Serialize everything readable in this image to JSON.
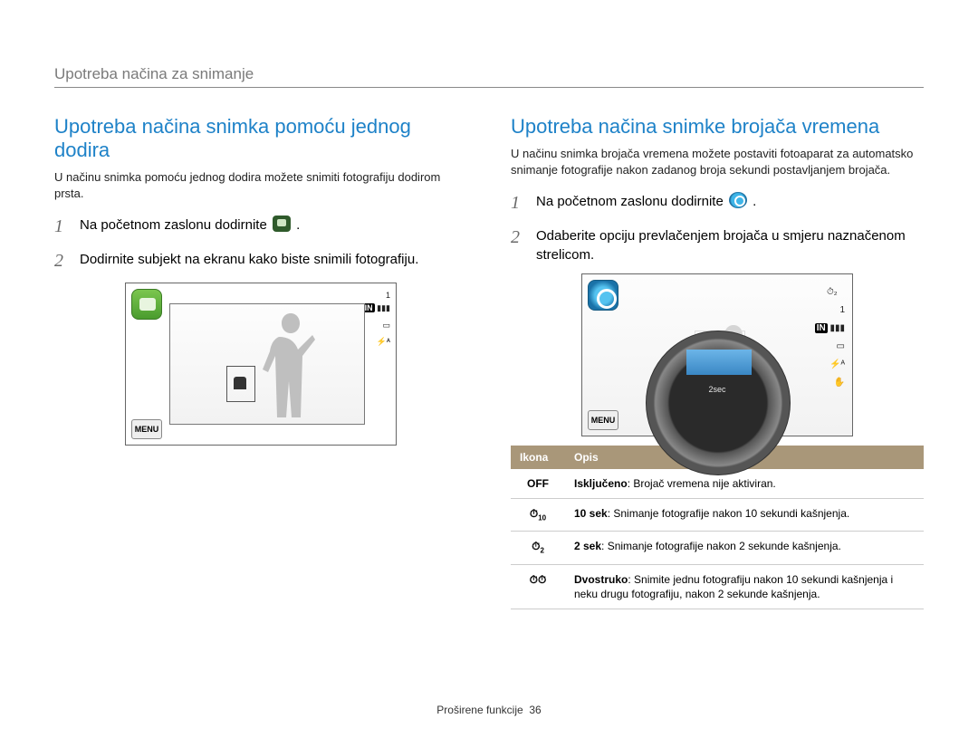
{
  "chapter_title": "Upotreba načina za snimanje",
  "left": {
    "title": "Upotreba načina snimka pomoću jednog dodira",
    "intro": "U načinu snimka pomoću jednog dodira možete snimiti fotografiju dodirom prsta.",
    "step1_pre": "Na početnom zaslonu dodirnite ",
    "step1_post": ".",
    "step2": "Dodirnite subjekt na ekranu kako biste snimili fotografiju.",
    "screen": {
      "menu": "MENU",
      "counter": "1",
      "in": "IN"
    }
  },
  "right": {
    "title": "Upotreba načina snimke brojača vremena",
    "intro": "U načinu snimka brojača vremena možete postaviti fotoaparat za automatsko snimanje fotografije nakon zadanog broja sekundi postavljanjem brojača.",
    "step1_pre": "Na početnom zaslonu dodirnite ",
    "step1_post": ".",
    "step2": "Odaberite opciju prevlačenjem brojača u smjeru naznačenom strelicom.",
    "screen": {
      "menu": "MENU",
      "counter": "1",
      "in": "IN",
      "dial_label": "2sec"
    },
    "table": {
      "header_icon": "Ikona",
      "header_desc": "Opis",
      "rows": [
        {
          "icon": "OFF",
          "bold": "Isključeno",
          "rest": ": Brojač vremena nije aktiviran."
        },
        {
          "icon_timer_sub": "10",
          "bold": "10 sek",
          "rest": ": Snimanje fotografije nakon 10 sekundi kašnjenja."
        },
        {
          "icon_timer_sub": "2",
          "bold": "2 sek",
          "rest": ": Snimanje fotografije nakon 2 sekunde kašnjenja."
        },
        {
          "icon_double": true,
          "bold": "Dvostruko",
          "rest": ": Snimite jednu fotografiju nakon 10 sekundi kašnjenja i neku drugu fotografiju, nakon 2 sekunde kašnjenja."
        }
      ]
    }
  },
  "footer": {
    "section": "Proširene funkcije",
    "page_number": "36"
  }
}
